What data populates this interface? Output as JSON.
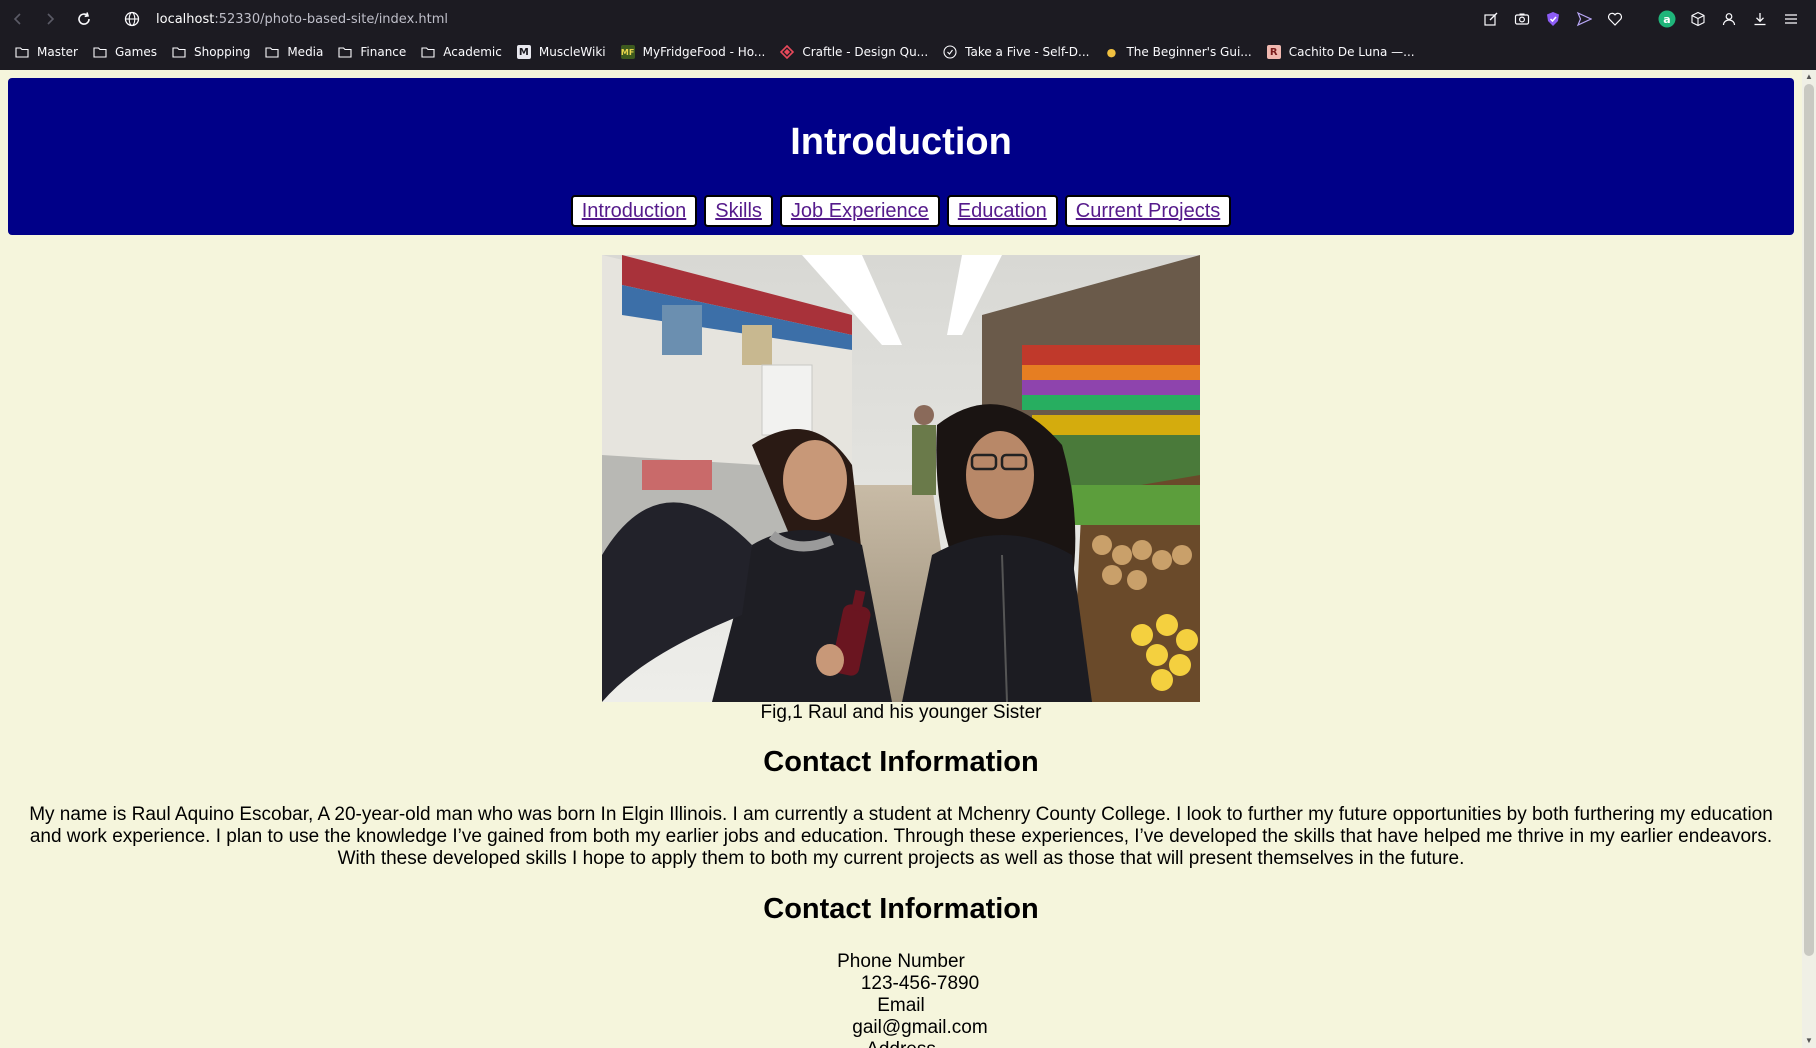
{
  "browser": {
    "url_host": "localhost",
    "url_rest": ":52330/photo-based-site/index.html"
  },
  "bookmarks": [
    {
      "label": "Master",
      "icon": "folder-icon"
    },
    {
      "label": "Games",
      "icon": "folder-icon"
    },
    {
      "label": "Shopping",
      "icon": "folder-icon"
    },
    {
      "label": "Media",
      "icon": "folder-icon"
    },
    {
      "label": "Finance",
      "icon": "folder-icon"
    },
    {
      "label": "Academic",
      "icon": "folder-icon"
    },
    {
      "label": "MuscleWiki",
      "icon": "musclewiki-favicon"
    },
    {
      "label": "MyFridgeFood - Ho...",
      "icon": "myfridgefood-favicon"
    },
    {
      "label": "Craftle - Design Qu...",
      "icon": "craftle-favicon"
    },
    {
      "label": "Take a Five - Self-D...",
      "icon": "takeafive-favicon"
    },
    {
      "label": "The Beginner's Gui...",
      "icon": "beginners-guide-favicon"
    },
    {
      "label": "Cachito De Luna —...",
      "icon": "cachito-favicon",
      "letter": "R"
    }
  ],
  "page": {
    "title": "Introduction",
    "nav": [
      "Introduction",
      "Skills",
      "Job Experience",
      "Education",
      "Current Projects"
    ],
    "photo_caption": "Fig,1 Raul and his younger Sister",
    "section1_heading": "Contact Information",
    "bio_line1": "My name is Raul Aquino Escobar, A 20-year-old man who was born In Elgin Illinois. I am currently a student at Mchenry County College. I look to further my future opportunities by both furthering my education",
    "bio_line2": "and work experience. I plan to use the knowledge I’ve gained from both my earlier jobs and education. Through these experiences, I’ve developed the skills that have helped me thrive in my earlier endeavors.",
    "bio_line3": "With these developed skills I hope to apply them to both my current projects as well as those that will present themselves in the future.",
    "section2_heading": "Contact Information",
    "contact": {
      "phone_label": "Phone Number",
      "phone_value": "123-456-7890",
      "email_label": "Email",
      "email_value": "gail@gmail.com",
      "address_label": "Address"
    }
  },
  "colors": {
    "header_bg": "#000088",
    "page_bg": "#f5f5dc",
    "link": "#551a8b",
    "chrome_bg": "#1c1b22"
  }
}
